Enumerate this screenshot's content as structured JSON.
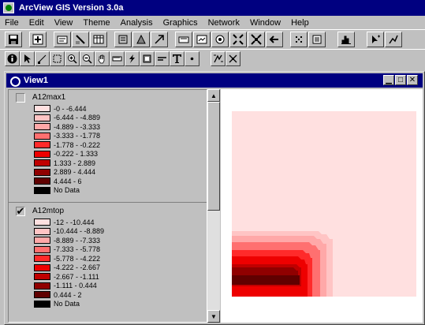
{
  "app_title": "ArcView GIS Version 3.0a",
  "menu": [
    "File",
    "Edit",
    "View",
    "Theme",
    "Analysis",
    "Graphics",
    "Network",
    "Window",
    "Help"
  ],
  "view": {
    "title": "View1",
    "themes": [
      {
        "name": "A12max1",
        "checked": false,
        "legend": [
          {
            "label": "-0 - -6.444",
            "color": "#ffe0e0"
          },
          {
            "label": "-6.444 - -4.889",
            "color": "#ffc4c4"
          },
          {
            "label": "-4.889 - -3.333",
            "color": "#ffa8a8"
          },
          {
            "label": "-3.333 - -1.778",
            "color": "#ff7070"
          },
          {
            "label": "-1.778 - -0.222",
            "color": "#ff2a2a"
          },
          {
            "label": "-0.222 - 1.333",
            "color": "#ee0000"
          },
          {
            "label": "1.333 - 2.889",
            "color": "#c00000"
          },
          {
            "label": "2.889 - 4.444",
            "color": "#900000"
          },
          {
            "label": "4.444 - 6",
            "color": "#600000"
          },
          {
            "label": "No Data",
            "color": "#000000"
          }
        ]
      },
      {
        "name": "A12mtop",
        "checked": true,
        "legend": [
          {
            "label": "-12 - -10.444",
            "color": "#ffe0e0"
          },
          {
            "label": "-10.444 - -8.889",
            "color": "#ffc4c4"
          },
          {
            "label": "-8.889 - -7.333",
            "color": "#ffa8a8"
          },
          {
            "label": "-7.333 - -5.778",
            "color": "#ff7070"
          },
          {
            "label": "-5.778 - -4.222",
            "color": "#ff2a2a"
          },
          {
            "label": "-4.222 - -2.667",
            "color": "#ee0000"
          },
          {
            "label": "-2.667 - -1.111",
            "color": "#c00000"
          },
          {
            "label": "-1.111 - 0.444",
            "color": "#900000"
          },
          {
            "label": "0.444 - 2",
            "color": "#600000"
          },
          {
            "label": "No Data",
            "color": "#000000"
          }
        ]
      }
    ]
  },
  "toolbar_icons": [
    "save-icon",
    "add-theme-icon",
    "theme-properties-icon",
    "edit-legend-icon",
    "open-table-icon",
    "find-icon",
    "query-builder-icon",
    "locate-address-icon",
    "zoom-full-extent-icon",
    "zoom-active-themes-icon",
    "zoom-selected-icon",
    "zoom-in-icon",
    "zoom-out-icon",
    "zoom-previous-icon",
    "select-by-theme-icon",
    "clear-selection-icon",
    "layout-icon",
    "help-icon"
  ]
}
